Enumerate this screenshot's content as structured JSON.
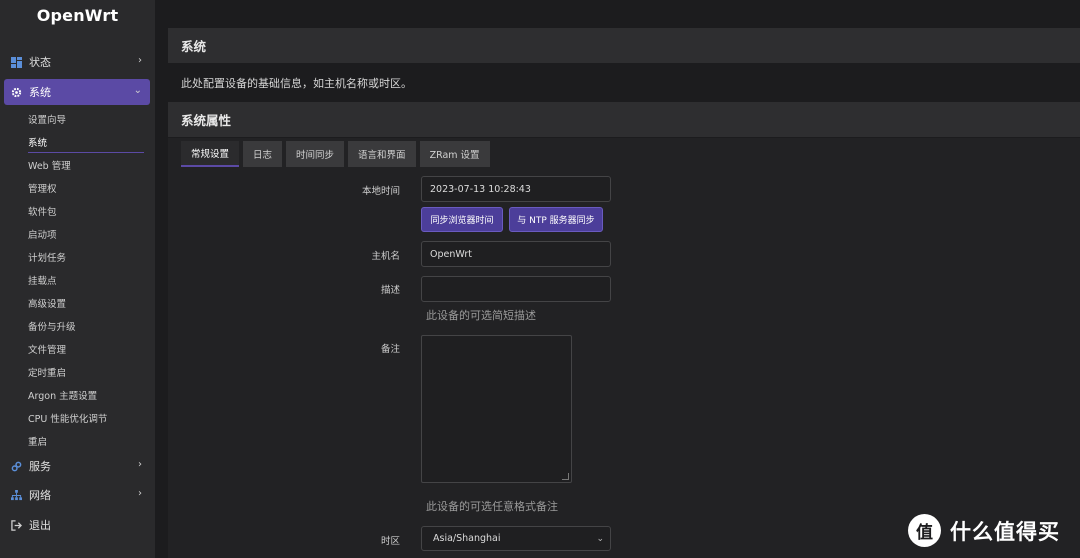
{
  "app": {
    "logo": "OpenWrt"
  },
  "sidebar": {
    "main": [
      {
        "label": "状态",
        "icon": "dashboard-icon"
      },
      {
        "label": "系统",
        "icon": "gear-icon"
      },
      {
        "label": "服务",
        "icon": "link-icon"
      },
      {
        "label": "网络",
        "icon": "network-icon"
      },
      {
        "label": "退出",
        "icon": "logout-icon"
      }
    ],
    "sub": [
      "设置向导",
      "系统",
      "Web 管理",
      "管理权",
      "软件包",
      "启动项",
      "计划任务",
      "挂载点",
      "高级设置",
      "备份与升级",
      "文件管理",
      "定时重启",
      "Argon 主题设置",
      "CPU 性能优化调节",
      "重启"
    ]
  },
  "page": {
    "title": "系统",
    "description": "此处配置设备的基础信息，如主机名称或时区。",
    "section_title": "系统属性"
  },
  "tabs": [
    "常规设置",
    "日志",
    "时间同步",
    "语言和界面",
    "ZRam 设置"
  ],
  "form": {
    "local_time_label": "本地时间",
    "local_time_value": "2023-07-13 10:28:43",
    "sync_browser_button": "同步浏览器时间",
    "sync_ntp_button": "与 NTP 服务器同步",
    "hostname_label": "主机名",
    "hostname_value": "OpenWrt",
    "description_label": "描述",
    "description_value": "",
    "description_hint": "此设备的可选简短描述",
    "notes_label": "备注",
    "notes_hint": "此设备的可选任意格式备注",
    "timezone_label": "时区",
    "timezone_value": "Asia/Shanghai"
  },
  "watermark": {
    "symbol": "值",
    "text": "什么值得买"
  },
  "colors": {
    "accent": "#5b4aa5",
    "sidebar_bg": "#2a2a2c",
    "page_bg": "#1c1c1e"
  }
}
